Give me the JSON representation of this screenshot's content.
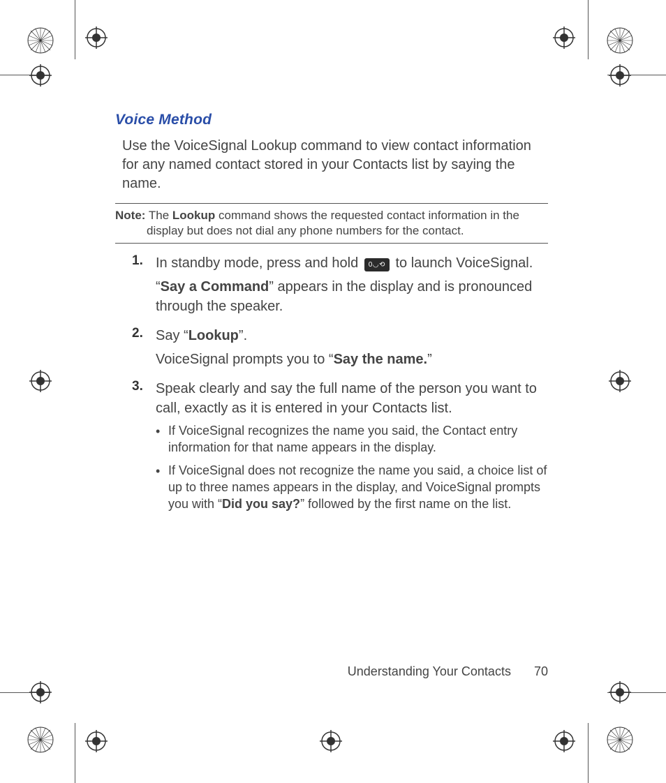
{
  "section_title": "Voice Method",
  "intro": "Use the VoiceSignal Lookup command to view contact information for any named contact stored in your Contacts list by saying the name.",
  "note": {
    "label": "Note:",
    "before": " The ",
    "bold": "Lookup",
    "after": " command shows the requested contact information in the display but does not dial any phone numbers for the contact."
  },
  "steps": [
    {
      "num": "1.",
      "lines": [
        {
          "parts": [
            {
              "t": "In standby mode, press and hold "
            },
            {
              "icon": "voice-key",
              "glyph": "0◡⟲"
            },
            {
              "t": " to launch VoiceSignal."
            }
          ]
        },
        {
          "parts": [
            {
              "t": "“"
            },
            {
              "b": "Say a Command"
            },
            {
              "t": "” appears in the display and is pronounced through the speaker."
            }
          ]
        }
      ]
    },
    {
      "num": "2.",
      "lines": [
        {
          "parts": [
            {
              "t": "Say “"
            },
            {
              "b": "Lookup"
            },
            {
              "t": "”."
            }
          ]
        },
        {
          "parts": [
            {
              "t": "VoiceSignal prompts you to “"
            },
            {
              "b": "Say the name."
            },
            {
              "t": "”"
            }
          ]
        }
      ]
    },
    {
      "num": "3.",
      "lines": [
        {
          "parts": [
            {
              "t": "Speak clearly and say the full name of the person you want to call, exactly as it is entered in your Contacts list."
            }
          ]
        }
      ],
      "bullets": [
        {
          "parts": [
            {
              "t": "If VoiceSignal recognizes the name you said, the Contact entry information for that name appears in the display."
            }
          ]
        },
        {
          "parts": [
            {
              "t": "If VoiceSignal does not recognize the name you said, a choice list of up to three names appears in the display, and VoiceSignal prompts you with “"
            },
            {
              "b": "Did you say?"
            },
            {
              "t": "” followed by the first name on the list."
            }
          ]
        }
      ]
    }
  ],
  "footer": {
    "section": "Understanding Your Contacts",
    "page": "70"
  }
}
